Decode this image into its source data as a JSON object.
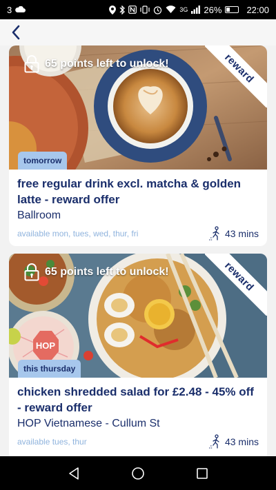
{
  "status_bar": {
    "notification_count": "3",
    "network": "3G",
    "battery_percent": "26%",
    "battery_level": 0.26,
    "time": "22:00"
  },
  "header": {
    "back_icon": "chevron-left-icon"
  },
  "offers": [
    {
      "lock_text": "65 points left to unlock!",
      "ribbon": "reward",
      "date_pill": "tomorrow",
      "title": "free regular drink excl. matcha & golden latte - reward offer",
      "venue": "Ballroom",
      "availability": "available mon, tues, wed, thur, fri",
      "walk_time": "43 mins"
    },
    {
      "lock_text": "65 points left to unlock!",
      "ribbon": "reward",
      "date_pill": "this thursday",
      "title": "chicken shredded salad for £2.48 - 45% off - reward offer",
      "venue": "HOP Vietnamese - Cullum St",
      "availability": "available tues, thur",
      "walk_time": "43 mins"
    }
  ],
  "colors": {
    "brand_navy": "#1a2e6b",
    "pill_blue": "#a7c7ec",
    "availability_blue": "#8fb3dd"
  }
}
